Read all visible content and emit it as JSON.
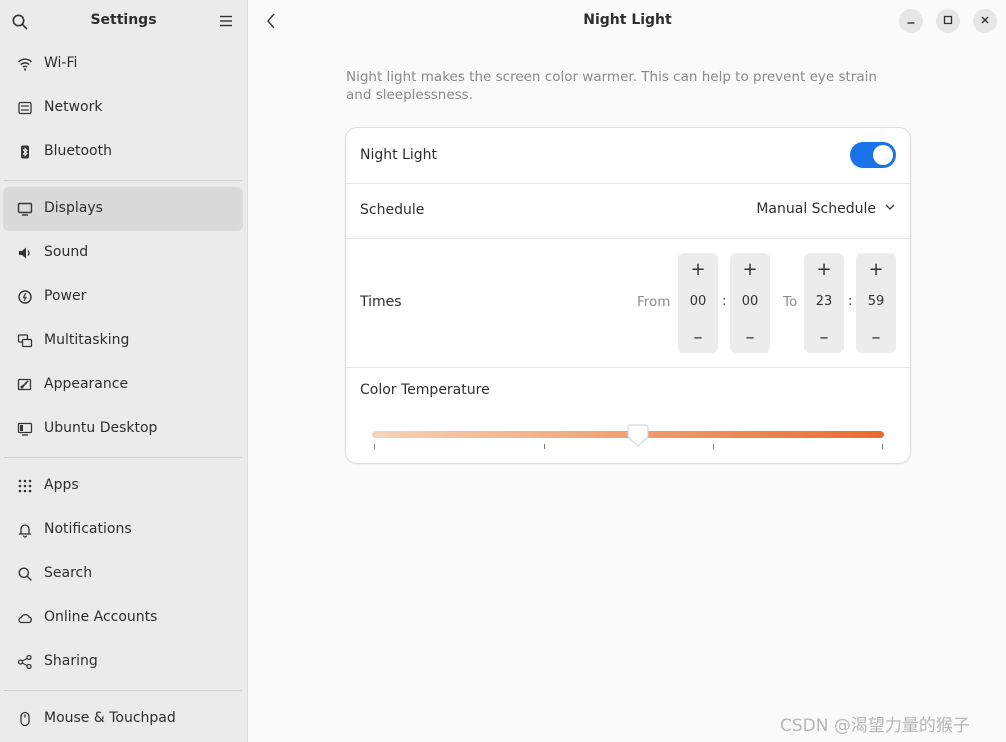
{
  "sidebar": {
    "title": "Settings",
    "items": [
      {
        "label": "Wi-Fi",
        "icon": "wifi-icon"
      },
      {
        "label": "Network",
        "icon": "network-icon"
      },
      {
        "label": "Bluetooth",
        "icon": "bluetooth-icon"
      },
      {
        "label": "Displays",
        "icon": "display-icon",
        "active": true
      },
      {
        "label": "Sound",
        "icon": "speaker-icon"
      },
      {
        "label": "Power",
        "icon": "power-icon"
      },
      {
        "label": "Multitasking",
        "icon": "multitasking-icon"
      },
      {
        "label": "Appearance",
        "icon": "appearance-icon"
      },
      {
        "label": "Ubuntu Desktop",
        "icon": "ubuntu-desktop-icon"
      },
      {
        "label": "Apps",
        "icon": "apps-grid-icon"
      },
      {
        "label": "Notifications",
        "icon": "bell-icon"
      },
      {
        "label": "Search",
        "icon": "search-icon"
      },
      {
        "label": "Online Accounts",
        "icon": "cloud-icon"
      },
      {
        "label": "Sharing",
        "icon": "share-icon"
      },
      {
        "label": "Mouse & Touchpad",
        "icon": "mouse-icon"
      }
    ]
  },
  "header": {
    "title": "Night Light"
  },
  "main": {
    "description": "Night light makes the screen color warmer. This can help to prevent eye strain and sleeplessness.",
    "night_light": {
      "label": "Night Light",
      "enabled": true
    },
    "schedule": {
      "label": "Schedule",
      "value": "Manual Schedule"
    },
    "times": {
      "label": "Times",
      "from_label": "From",
      "to_label": "To",
      "from_hour": "00",
      "from_minute": "00",
      "to_hour": "23",
      "to_minute": "59",
      "colon": ":",
      "plus": "+",
      "minus": "–"
    },
    "color_temperature": {
      "label": "Color Temperature",
      "level": 0.52
    }
  },
  "watermark": "CSDN @渴望力量的猴子",
  "colors": {
    "accent": "#1a73e8",
    "sidebar_bg": "#ebebeb",
    "active_item_bg": "#dadada",
    "warm_start": "#f6d4b8",
    "warm_end": "#eb6b2d"
  }
}
